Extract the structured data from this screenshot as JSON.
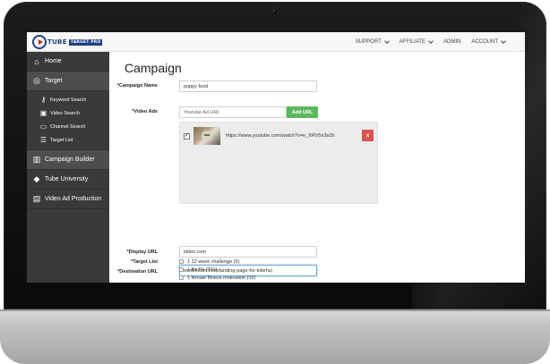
{
  "brand": {
    "logo_text": "TUBE",
    "logo_sub": "TARGET PRO"
  },
  "nav": {
    "support": "SUPPORT",
    "affiliate": "AFFILIATE",
    "admin": "ADMIN",
    "account": "ACCOUNT"
  },
  "sidebar": {
    "items": [
      {
        "label": "Home",
        "icon": "home-icon"
      },
      {
        "label": "Target",
        "icon": "target-icon"
      },
      {
        "label": "Campaign Builder",
        "icon": "chart-icon"
      },
      {
        "label": "Tube University",
        "icon": "graduation-cap-icon"
      },
      {
        "label": "Video Ad Production",
        "icon": "film-icon"
      }
    ],
    "target_subitems": [
      {
        "label": "Keyword Search",
        "icon": "key-icon"
      },
      {
        "label": "Video Search",
        "icon": "video-camera-icon"
      },
      {
        "label": "Channel Search",
        "icon": "tv-icon"
      },
      {
        "label": "Target List",
        "icon": "list-icon"
      }
    ]
  },
  "main": {
    "title": "Campaign",
    "campaign_name": {
      "label": "*Campaign Name",
      "value": "puppy food"
    },
    "video_ads": {
      "label": "*Video Ads",
      "placeholder": "Youtube Ad URL",
      "add_button": "Add URL",
      "items": [
        {
          "checked": "✓",
          "url": "https://www.youtube.com/watch?v=e_XRV5n3oZk",
          "remove": "x"
        }
      ]
    },
    "display_url": {
      "label": "*Display URL",
      "value": "kitten.com"
    },
    "destination_url": {
      "label": "*Destination URL",
      "value": "www.kitten.com/landing-page-for-kittehs|"
    },
    "target_list": {
      "label": "*Target List",
      "items": [
        {
          "label": "1 12 week challenge (5)"
        },
        {
          "label": "1 Be Fit (901)"
        },
        {
          "label": "1 female fitness motivation (10)"
        }
      ]
    }
  }
}
